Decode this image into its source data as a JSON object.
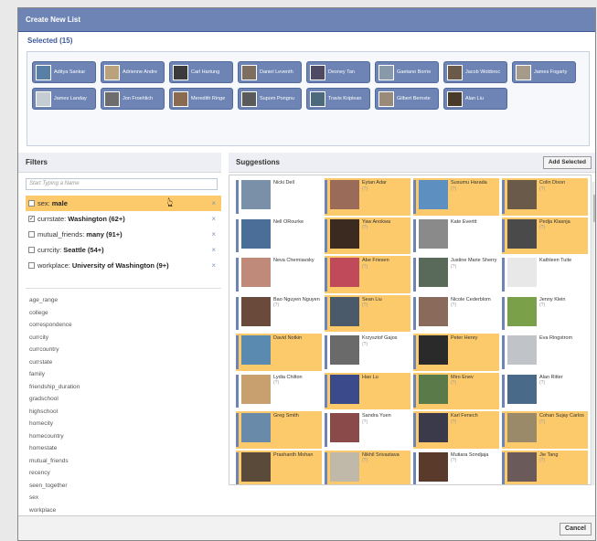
{
  "dialog": {
    "title": "Create New List"
  },
  "selected": {
    "heading": "Selected (15)",
    "chips": [
      {
        "label": "Aditya Sankar",
        "color": "#5a7fa6"
      },
      {
        "label": "Adrienne Andre",
        "color": "#b9a27c"
      },
      {
        "label": "Carl Hartung",
        "color": "#3b3b3b"
      },
      {
        "label": "Daniel Leventh",
        "color": "#7d6e60"
      },
      {
        "label": "Desney Tan",
        "color": "#4e4a63"
      },
      {
        "label": "Gaetano Borrie",
        "color": "#8899aa"
      },
      {
        "label": "Jacob Wobbroc",
        "color": "#6b5a4a"
      },
      {
        "label": "James Fogarty",
        "color": "#a69a8a"
      },
      {
        "label": "James Landay",
        "color": "#c4ccd4"
      },
      {
        "label": "Jon Froehlich",
        "color": "#6d6d6d"
      },
      {
        "label": "Meredith Ringe",
        "color": "#8a6a50"
      },
      {
        "label": "Supom Pongnu",
        "color": "#5a5a5a"
      },
      {
        "label": "Travis Kriplean",
        "color": "#4c6a7c"
      },
      {
        "label": "Gilbert Bernste",
        "color": "#9a8a7a"
      },
      {
        "label": "Alan Liu",
        "color": "#4a3a2a"
      }
    ]
  },
  "filters": {
    "heading": "Filters",
    "input_placeholder": "Start Typing a Name",
    "active": [
      {
        "key": "sex:",
        "value": "male",
        "checked": "",
        "highlight": true
      },
      {
        "key": "currstate:",
        "value": "Washington (62+)",
        "checked": "✓",
        "highlight": false
      },
      {
        "key": "mutual_friends:",
        "value": "many (91+)",
        "checked": "",
        "highlight": false
      },
      {
        "key": "currcity:",
        "value": "Seattle (54+)",
        "checked": "",
        "highlight": false
      },
      {
        "key": "workplace:",
        "value": "University of Washington (9+)",
        "checked": "",
        "highlight": false
      }
    ],
    "remove_glyph": "×",
    "attributes": [
      "age_range",
      "college",
      "correspondence",
      "currcity",
      "currcountry",
      "currstate",
      "family",
      "friendship_duration",
      "gradschool",
      "highschool",
      "homecity",
      "homecountry",
      "homestate",
      "mutual_friends",
      "recency",
      "seen_together",
      "sex",
      "workplace"
    ],
    "less_label": "Less"
  },
  "suggestions": {
    "heading": "Suggestions",
    "add_selected_label": "Add Selected",
    "people": [
      {
        "name": "Nicki Dell",
        "sub": "",
        "selected": false,
        "color": "#7a8fa8"
      },
      {
        "name": "Eytan Adar",
        "sub": "(?)",
        "selected": true,
        "color": "#9b6b5a"
      },
      {
        "name": "Susumu Harada",
        "sub": "(?)",
        "selected": true,
        "color": "#5d8fc0"
      },
      {
        "name": "Colin Dixon",
        "sub": "(?)",
        "selected": true,
        "color": "#6a5a4a"
      },
      {
        "name": "Nell ORourke",
        "sub": "",
        "selected": false,
        "color": "#4b6e99"
      },
      {
        "name": "Yaw Anokwa",
        "sub": "(?)",
        "selected": true,
        "color": "#3a2a20"
      },
      {
        "name": "Kate Everitt",
        "sub": "",
        "selected": false,
        "color": "#8a8a8a"
      },
      {
        "name": "Pedja Klasnja",
        "sub": "(?)",
        "selected": true,
        "color": "#4a4a4a"
      },
      {
        "name": "Neva Cherniavsky",
        "sub": "",
        "selected": false,
        "color": "#c08a7a"
      },
      {
        "name": "Abe Friesen",
        "sub": "(?)",
        "selected": true,
        "color": "#c04a5a"
      },
      {
        "name": "Justine Marie Sherry",
        "sub": "(?)",
        "selected": false,
        "color": "#5a6a5a"
      },
      {
        "name": "Kathleen Tuite",
        "sub": "",
        "selected": false,
        "color": "#e8e8e8"
      },
      {
        "name": "Bao Nguyen Nguyen",
        "sub": "(?)",
        "selected": false,
        "color": "#6a4a3a"
      },
      {
        "name": "Sean Liu",
        "sub": "(?)",
        "selected": true,
        "color": "#4a5a6a"
      },
      {
        "name": "Nicole Cederblom",
        "sub": "(?)",
        "selected": false,
        "color": "#8a6a5a"
      },
      {
        "name": "Jenny Klein",
        "sub": "(?)",
        "selected": false,
        "color": "#7aa04a"
      },
      {
        "name": "David Notkin",
        "sub": "",
        "selected": true,
        "color": "#5a8ab0"
      },
      {
        "name": "Krzysztof Gajos",
        "sub": "(?)",
        "selected": false,
        "color": "#6a6a6a"
      },
      {
        "name": "Peter Henry",
        "sub": "",
        "selected": true,
        "color": "#2a2a2a"
      },
      {
        "name": "Eva Ringstrom",
        "sub": "",
        "selected": false,
        "color": "#c0c4c8"
      },
      {
        "name": "Lydia Chilton",
        "sub": "(?)",
        "selected": false,
        "color": "#c8a070"
      },
      {
        "name": "Hao Lu",
        "sub": "",
        "selected": true,
        "color": "#3a4a8a"
      },
      {
        "name": "Miro Enev",
        "sub": "(?)",
        "selected": true,
        "color": "#5a7a4a"
      },
      {
        "name": "Alan Ritter",
        "sub": "(?)",
        "selected": false,
        "color": "#4a6a8a"
      },
      {
        "name": "Greg Smith",
        "sub": "",
        "selected": true,
        "color": "#6a8aaa"
      },
      {
        "name": "Sandra Yuen",
        "sub": "(?)",
        "selected": false,
        "color": "#8a4a4a"
      },
      {
        "name": "Karl Fenech",
        "sub": "(?)",
        "selected": true,
        "color": "#3a3a4a"
      },
      {
        "name": "Cohan Sujay Carlos",
        "sub": "(?)",
        "selected": true,
        "color": "#9a8a6a"
      },
      {
        "name": "Prashanth Mohan",
        "sub": "",
        "selected": true,
        "color": "#5a4a3a"
      },
      {
        "name": "Nikhil Srivastava",
        "sub": "(?)",
        "selected": true,
        "color": "#c0b8a8"
      },
      {
        "name": "Mutiara Sondjaja",
        "sub": "(?)",
        "selected": false,
        "color": "#5a3a2a"
      },
      {
        "name": "Jie Tang",
        "sub": "(?)",
        "selected": true,
        "color": "#6a5a5a"
      }
    ]
  },
  "footer": {
    "cancel_label": "Cancel"
  }
}
